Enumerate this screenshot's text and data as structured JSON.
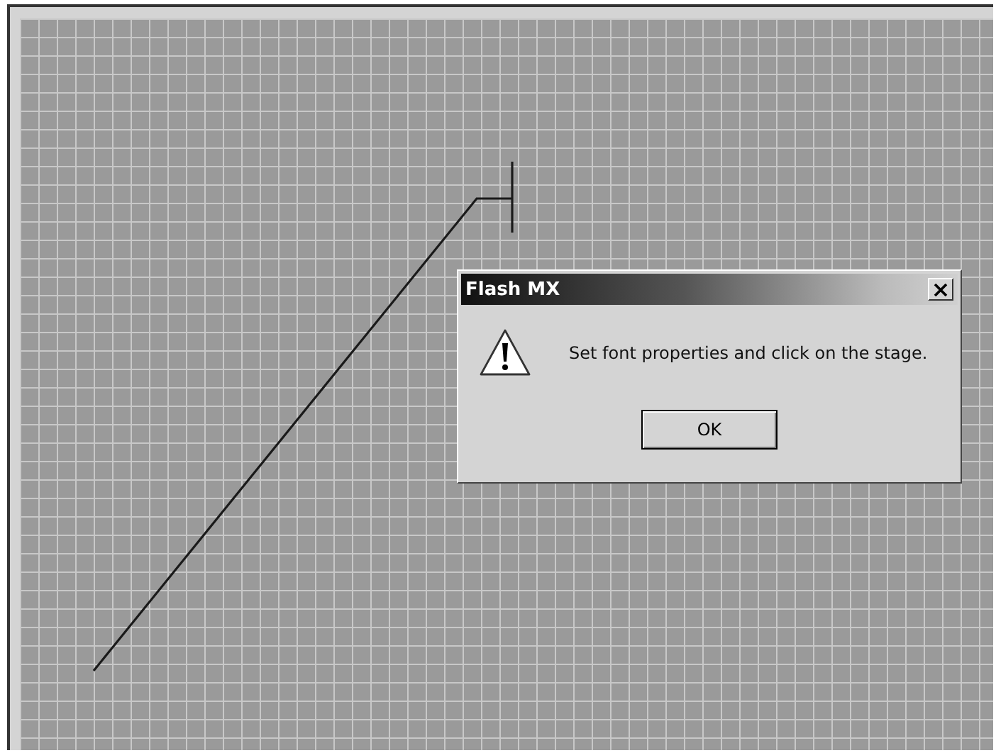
{
  "dialog": {
    "title": "Flash MX",
    "message": "Set font properties and click on the stage.",
    "buttons": [
      "OK"
    ]
  }
}
